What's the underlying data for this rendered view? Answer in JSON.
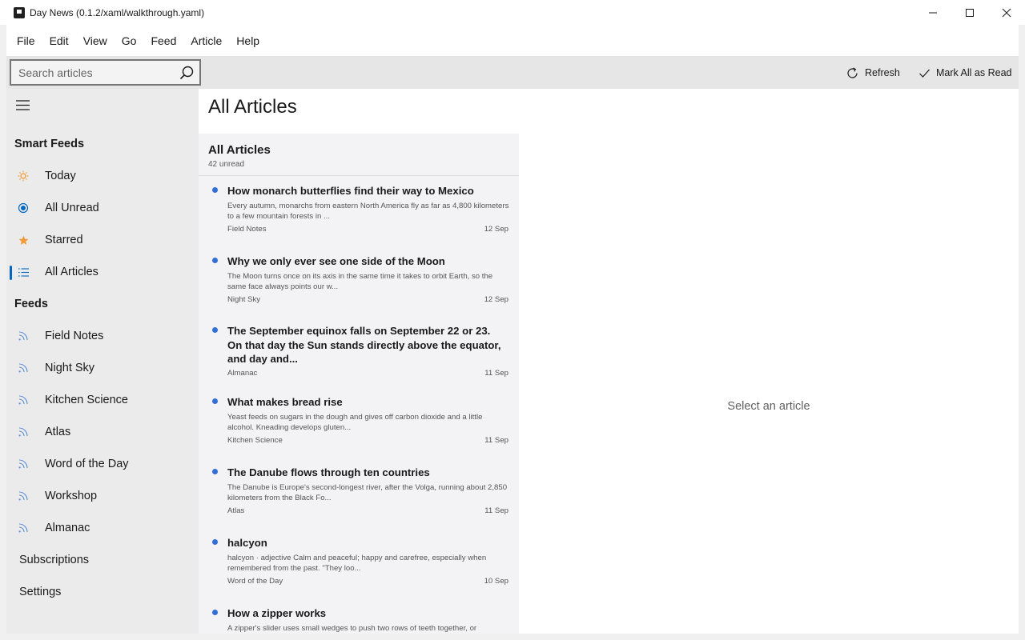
{
  "window": {
    "title": "Day News (0.1.2/xaml/walkthrough.yaml)"
  },
  "menu": [
    "File",
    "Edit",
    "View",
    "Go",
    "Feed",
    "Article",
    "Help"
  ],
  "toolbar": {
    "search_placeholder": "Search articles",
    "refresh_label": "Refresh",
    "mark_all_read_label": "Mark All as Read"
  },
  "sidebar": {
    "smart_feeds_header": "Smart Feeds",
    "smart_feeds": [
      {
        "label": "Today",
        "icon": "sun-icon",
        "color": "#f29b38"
      },
      {
        "label": "All Unread",
        "icon": "radio-dot-icon",
        "color": "#0067c0"
      },
      {
        "label": "Starred",
        "icon": "star-icon",
        "color": "#f29b38"
      },
      {
        "label": "All Articles",
        "icon": "list-icon",
        "color": "#0067c0",
        "selected": true
      }
    ],
    "feeds_header": "Feeds",
    "feeds": [
      {
        "label": "Field Notes",
        "icon": "rss-icon"
      },
      {
        "label": "Night Sky",
        "icon": "rss-icon"
      },
      {
        "label": "Kitchen Science",
        "icon": "rss-icon"
      },
      {
        "label": "Atlas",
        "icon": "rss-icon"
      },
      {
        "label": "Word of the Day",
        "icon": "rss-icon"
      },
      {
        "label": "Workshop",
        "icon": "rss-icon"
      },
      {
        "label": "Almanac",
        "icon": "rss-icon"
      }
    ],
    "subscriptions_label": "Subscriptions",
    "settings_label": "Settings"
  },
  "main": {
    "page_title": "All Articles",
    "list_title": "All Articles",
    "unread_count": "42 unread",
    "articles": [
      {
        "title": "How monarch butterflies find their way to Mexico",
        "excerpt": "Every autumn, monarchs from eastern North America fly as far as 4,800 kilometers to a few mountain forests in ...",
        "feed": "Field Notes",
        "date": "12 Sep",
        "unread": true
      },
      {
        "title": "Why we only ever see one side of the Moon",
        "excerpt": "The Moon turns once on its axis in the same time it takes to orbit Earth, so the same face always points our w...",
        "feed": "Night Sky",
        "date": "12 Sep",
        "unread": true
      },
      {
        "title": "The September equinox falls on September 22 or 23. On that day the Sun stands directly above the equator, and day and...",
        "excerpt": "",
        "feed": "Almanac",
        "date": "11 Sep",
        "unread": true
      },
      {
        "title": "What makes bread rise",
        "excerpt": "Yeast feeds on sugars in the dough and gives off carbon dioxide and a little alcohol. Kneading develops gluten...",
        "feed": "Kitchen Science",
        "date": "11 Sep",
        "unread": true
      },
      {
        "title": "The Danube flows through ten countries",
        "excerpt": "The Danube is Europe's second-longest river, after the Volga, running about 2,850 kilometers from the Black Fo...",
        "feed": "Atlas",
        "date": "11 Sep",
        "unread": true
      },
      {
        "title": "halcyon",
        "excerpt": "halcyon · adjective Calm and peaceful; happy and carefree, especially when remembered from the past. \"They loo...",
        "feed": "Word of the Day",
        "date": "10 Sep",
        "unread": true
      },
      {
        "title": "How a zipper works",
        "excerpt": "A zipper's slider uses small wedges to push two rows of teeth together, or",
        "feed": "",
        "date": "",
        "unread": true
      }
    ],
    "reader_empty": "Select an article"
  }
}
